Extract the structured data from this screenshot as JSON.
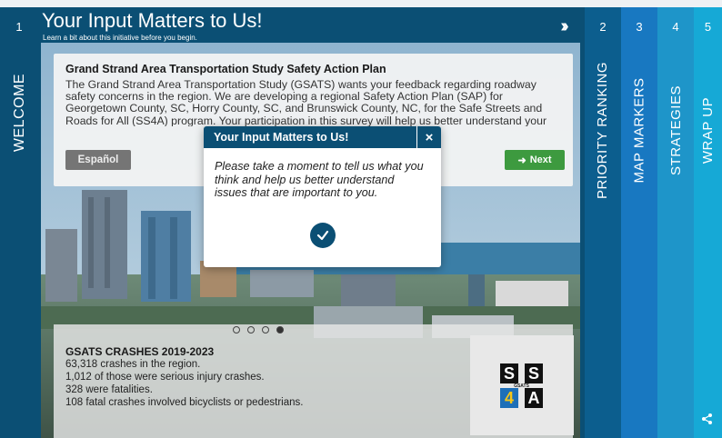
{
  "header": {
    "step_number": "1",
    "title": "Your Input Matters to Us!",
    "subtitle": "Learn a bit about this initiative before you begin.",
    "collapse_icon": "double-chevron-right-icon"
  },
  "welcome_tab": {
    "label": "WELCOME"
  },
  "side_tabs": [
    {
      "number": "2",
      "label": "PRIORITY RANKING",
      "color": "#0c5e8e"
    },
    {
      "number": "3",
      "label": "MAP MARKERS",
      "color": "#1878c1"
    },
    {
      "number": "4",
      "label": "STRATEGIES",
      "color": "#1e95c9"
    },
    {
      "number": "5",
      "label": "WRAP UP",
      "color": "#16a9d6"
    }
  ],
  "intro": {
    "heading": "Grand Strand Area Transportation Study Safety Action Plan",
    "body": "The Grand Strand Area Transportation Study (GSATS) wants your feedback regarding roadway safety concerns in the region. We are developing a regional Safety Action Plan (SAP) for Georgetown County, SC, Horry County, SC, and Brunswick County, NC, for the Safe Streets and Roads for All (SS4A) program. Your participation in this survey will help us better understand your concerns.",
    "spanish_button": "Español",
    "next_button": "Next",
    "next_icon": "arrow-right-icon"
  },
  "carousel": {
    "total": 4,
    "active_index": 4
  },
  "stats": {
    "title": "GSATS CRASHES 2019-2023",
    "lines": [
      "63,318 crashes in the region.",
      "1,012 of those were serious injury crashes.",
      "328 were fatalities.",
      "108 fatal crashes involved bicyclists or pedestrians."
    ]
  },
  "logo": {
    "letters": [
      "S",
      "S",
      "4",
      "A"
    ],
    "center_text": "GSATS"
  },
  "modal": {
    "title": "Your Input Matters to Us!",
    "close_label": "×",
    "body": "Please take a moment to tell us what you think and help us better understand issues that are important to you.",
    "ok_icon": "checkmark-icon"
  },
  "share_icon": "share-icon",
  "colors": {
    "primary": "#0b4f74",
    "next_green": "#3d9a3f",
    "spanish_gray": "#757575"
  }
}
